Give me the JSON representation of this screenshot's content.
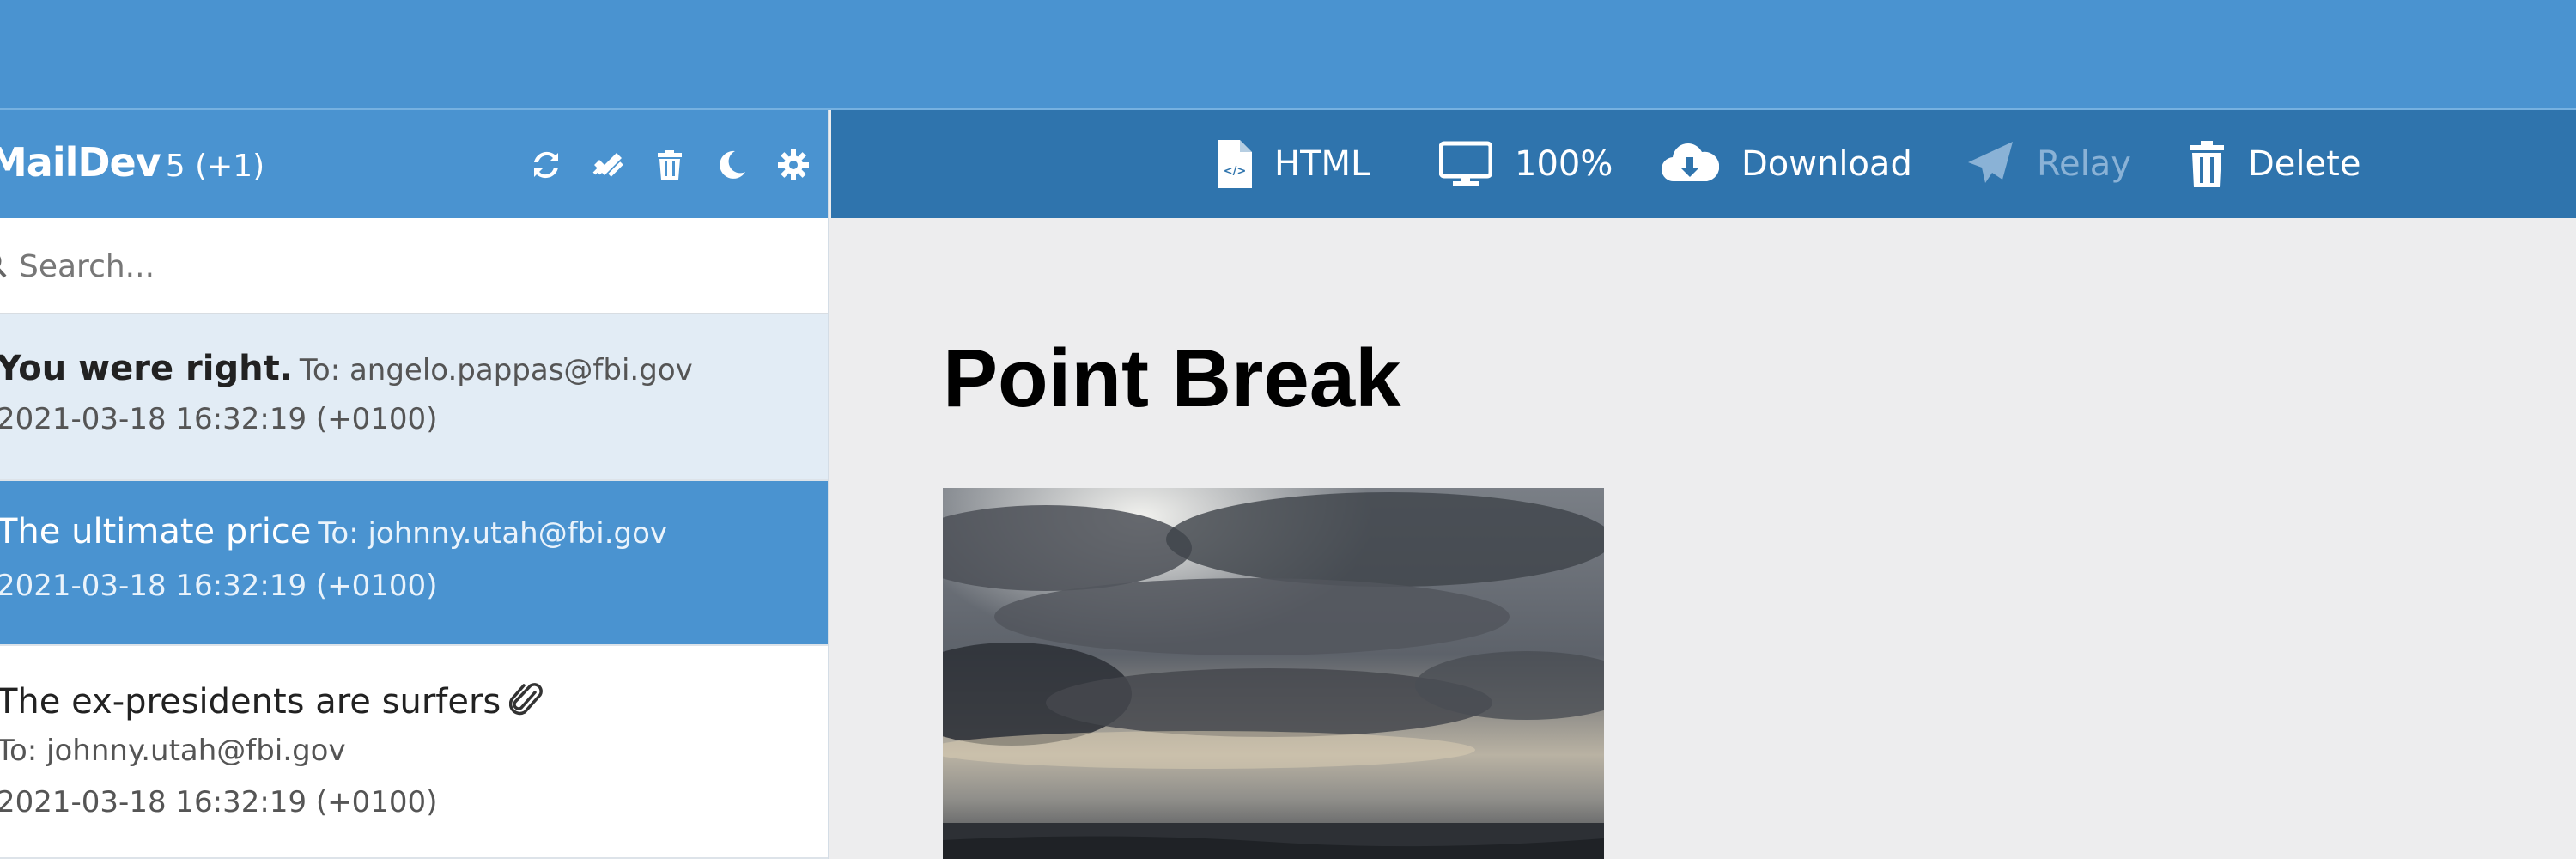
{
  "app": {
    "name": "MailDev",
    "count": "5 (+1)"
  },
  "sidebar": {
    "icons": [
      "refresh-icon",
      "mark-all-read-icon",
      "trash-icon",
      "moon-icon",
      "gear-icon"
    ],
    "search": {
      "placeholder": "Search..."
    },
    "emails": [
      {
        "subject": "You were right.",
        "to": "To: angelo.pappas@fbi.gov",
        "date": "2021-03-18 16:32:19 (+0100)",
        "unread": true,
        "selected": false
      },
      {
        "subject": "The ultimate price",
        "to": "To: johnny.utah@fbi.gov",
        "date": "2021-03-18 16:32:19 (+0100)",
        "unread": false,
        "selected": true
      },
      {
        "subject": "The ex-presidents are surfers",
        "to": "To: johnny.utah@fbi.gov",
        "date": "2021-03-18 16:32:19 (+0100)",
        "has_attachment": true,
        "unread": false,
        "selected": false
      }
    ]
  },
  "toolbar": {
    "html_label": "HTML",
    "zoom_label": "100%",
    "download_label": "Download",
    "relay_label": "Relay",
    "delete_label": "Delete"
  },
  "message": {
    "title": "Point Break",
    "image": "stormy-ocean-clouds-photo"
  },
  "colors": {
    "header": "#4a93d0",
    "toolbar": "#2f74ad",
    "selected_item": "#4a93d0",
    "unread_item": "#e2ecf5",
    "content_bg": "#ededee"
  }
}
